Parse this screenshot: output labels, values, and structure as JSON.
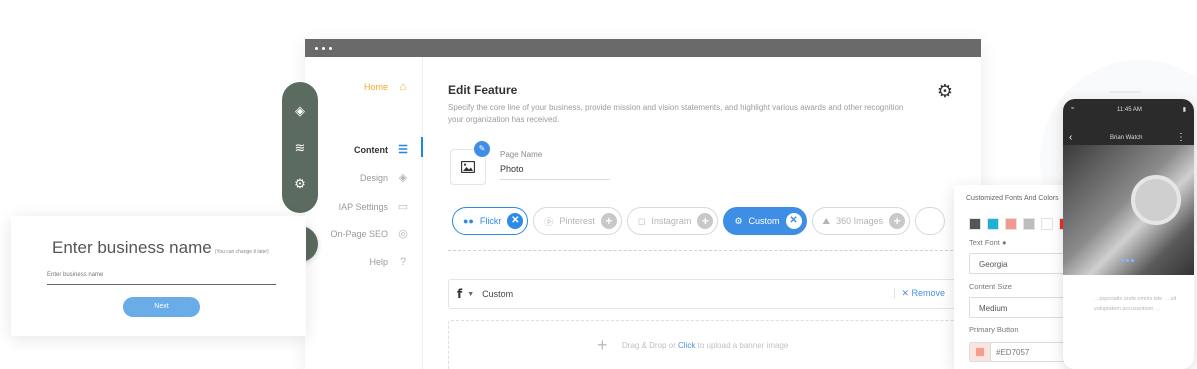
{
  "nav": {
    "home": "Home",
    "content": "Content",
    "design": "Design",
    "iap_settings": "IAP Settings",
    "onpage_seo": "On-Page SEO",
    "help": "Help"
  },
  "editor": {
    "title": "Edit Feature",
    "description": "Specify the core line of your business, provide mission and vision statements, and highlight various awards and other recognition your organization has received.",
    "page_name_label": "Page Name",
    "page_name_value": "Photo",
    "tabs": [
      {
        "label": "Flickr",
        "state": "selected"
      },
      {
        "label": "Pinterest",
        "state": "add"
      },
      {
        "label": "Instagram",
        "state": "add"
      },
      {
        "label": "Custom",
        "state": "active"
      },
      {
        "label": "360 Images",
        "state": "add"
      }
    ],
    "social_row": {
      "name": "Custom",
      "remove_label": "Remove"
    },
    "upload": {
      "prefix": "Drag & Drop or ",
      "click": "Click",
      "suffix": " to upload a banner image"
    }
  },
  "business_card": {
    "title": "Enter business name",
    "hint": "(You can change it later)",
    "input_placeholder": "Enter business name",
    "next_label": "Next"
  },
  "custom_panel": {
    "title": "Customized Fonts And Colors",
    "swatches": [
      "#555555",
      "#1ab3d8",
      "#f49a8c",
      "#bdbdbd",
      "#ffffff",
      "#ee2d2d"
    ],
    "text_font_label": "Text Font",
    "text_font_value": "Georgia",
    "content_size_label": "Content Size",
    "content_size_value": "Medium",
    "primary_button_label": "Primary Button",
    "primary_button_value": "#ED7057"
  },
  "phone": {
    "time": "11:45 AM",
    "title": "Brian Watch",
    "body_text": "…pspiciatis unde omnis iste … sit voluptatem accusantium …"
  },
  "colors": {
    "accent_blue": "#3f8ee6",
    "home_orange": "#f5a623",
    "toolbar_green": "#5b6b5f"
  }
}
